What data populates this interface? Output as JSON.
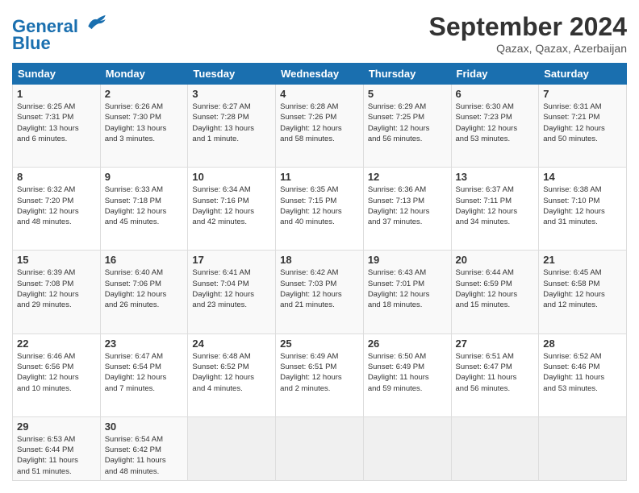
{
  "header": {
    "logo_line1": "General",
    "logo_line2": "Blue",
    "title": "September 2024",
    "subtitle": "Qazax, Qazax, Azerbaijan"
  },
  "weekdays": [
    "Sunday",
    "Monday",
    "Tuesday",
    "Wednesday",
    "Thursday",
    "Friday",
    "Saturday"
  ],
  "weeks": [
    [
      {
        "day": "1",
        "lines": [
          "Sunrise: 6:25 AM",
          "Sunset: 7:31 PM",
          "Daylight: 13 hours",
          "and 6 minutes."
        ]
      },
      {
        "day": "2",
        "lines": [
          "Sunrise: 6:26 AM",
          "Sunset: 7:30 PM",
          "Daylight: 13 hours",
          "and 3 minutes."
        ]
      },
      {
        "day": "3",
        "lines": [
          "Sunrise: 6:27 AM",
          "Sunset: 7:28 PM",
          "Daylight: 13 hours",
          "and 1 minute."
        ]
      },
      {
        "day": "4",
        "lines": [
          "Sunrise: 6:28 AM",
          "Sunset: 7:26 PM",
          "Daylight: 12 hours",
          "and 58 minutes."
        ]
      },
      {
        "day": "5",
        "lines": [
          "Sunrise: 6:29 AM",
          "Sunset: 7:25 PM",
          "Daylight: 12 hours",
          "and 56 minutes."
        ]
      },
      {
        "day": "6",
        "lines": [
          "Sunrise: 6:30 AM",
          "Sunset: 7:23 PM",
          "Daylight: 12 hours",
          "and 53 minutes."
        ]
      },
      {
        "day": "7",
        "lines": [
          "Sunrise: 6:31 AM",
          "Sunset: 7:21 PM",
          "Daylight: 12 hours",
          "and 50 minutes."
        ]
      }
    ],
    [
      {
        "day": "8",
        "lines": [
          "Sunrise: 6:32 AM",
          "Sunset: 7:20 PM",
          "Daylight: 12 hours",
          "and 48 minutes."
        ]
      },
      {
        "day": "9",
        "lines": [
          "Sunrise: 6:33 AM",
          "Sunset: 7:18 PM",
          "Daylight: 12 hours",
          "and 45 minutes."
        ]
      },
      {
        "day": "10",
        "lines": [
          "Sunrise: 6:34 AM",
          "Sunset: 7:16 PM",
          "Daylight: 12 hours",
          "and 42 minutes."
        ]
      },
      {
        "day": "11",
        "lines": [
          "Sunrise: 6:35 AM",
          "Sunset: 7:15 PM",
          "Daylight: 12 hours",
          "and 40 minutes."
        ]
      },
      {
        "day": "12",
        "lines": [
          "Sunrise: 6:36 AM",
          "Sunset: 7:13 PM",
          "Daylight: 12 hours",
          "and 37 minutes."
        ]
      },
      {
        "day": "13",
        "lines": [
          "Sunrise: 6:37 AM",
          "Sunset: 7:11 PM",
          "Daylight: 12 hours",
          "and 34 minutes."
        ]
      },
      {
        "day": "14",
        "lines": [
          "Sunrise: 6:38 AM",
          "Sunset: 7:10 PM",
          "Daylight: 12 hours",
          "and 31 minutes."
        ]
      }
    ],
    [
      {
        "day": "15",
        "lines": [
          "Sunrise: 6:39 AM",
          "Sunset: 7:08 PM",
          "Daylight: 12 hours",
          "and 29 minutes."
        ]
      },
      {
        "day": "16",
        "lines": [
          "Sunrise: 6:40 AM",
          "Sunset: 7:06 PM",
          "Daylight: 12 hours",
          "and 26 minutes."
        ]
      },
      {
        "day": "17",
        "lines": [
          "Sunrise: 6:41 AM",
          "Sunset: 7:04 PM",
          "Daylight: 12 hours",
          "and 23 minutes."
        ]
      },
      {
        "day": "18",
        "lines": [
          "Sunrise: 6:42 AM",
          "Sunset: 7:03 PM",
          "Daylight: 12 hours",
          "and 21 minutes."
        ]
      },
      {
        "day": "19",
        "lines": [
          "Sunrise: 6:43 AM",
          "Sunset: 7:01 PM",
          "Daylight: 12 hours",
          "and 18 minutes."
        ]
      },
      {
        "day": "20",
        "lines": [
          "Sunrise: 6:44 AM",
          "Sunset: 6:59 PM",
          "Daylight: 12 hours",
          "and 15 minutes."
        ]
      },
      {
        "day": "21",
        "lines": [
          "Sunrise: 6:45 AM",
          "Sunset: 6:58 PM",
          "Daylight: 12 hours",
          "and 12 minutes."
        ]
      }
    ],
    [
      {
        "day": "22",
        "lines": [
          "Sunrise: 6:46 AM",
          "Sunset: 6:56 PM",
          "Daylight: 12 hours",
          "and 10 minutes."
        ]
      },
      {
        "day": "23",
        "lines": [
          "Sunrise: 6:47 AM",
          "Sunset: 6:54 PM",
          "Daylight: 12 hours",
          "and 7 minutes."
        ]
      },
      {
        "day": "24",
        "lines": [
          "Sunrise: 6:48 AM",
          "Sunset: 6:52 PM",
          "Daylight: 12 hours",
          "and 4 minutes."
        ]
      },
      {
        "day": "25",
        "lines": [
          "Sunrise: 6:49 AM",
          "Sunset: 6:51 PM",
          "Daylight: 12 hours",
          "and 2 minutes."
        ]
      },
      {
        "day": "26",
        "lines": [
          "Sunrise: 6:50 AM",
          "Sunset: 6:49 PM",
          "Daylight: 11 hours",
          "and 59 minutes."
        ]
      },
      {
        "day": "27",
        "lines": [
          "Sunrise: 6:51 AM",
          "Sunset: 6:47 PM",
          "Daylight: 11 hours",
          "and 56 minutes."
        ]
      },
      {
        "day": "28",
        "lines": [
          "Sunrise: 6:52 AM",
          "Sunset: 6:46 PM",
          "Daylight: 11 hours",
          "and 53 minutes."
        ]
      }
    ],
    [
      {
        "day": "29",
        "lines": [
          "Sunrise: 6:53 AM",
          "Sunset: 6:44 PM",
          "Daylight: 11 hours",
          "and 51 minutes."
        ]
      },
      {
        "day": "30",
        "lines": [
          "Sunrise: 6:54 AM",
          "Sunset: 6:42 PM",
          "Daylight: 11 hours",
          "and 48 minutes."
        ]
      },
      null,
      null,
      null,
      null,
      null
    ]
  ]
}
